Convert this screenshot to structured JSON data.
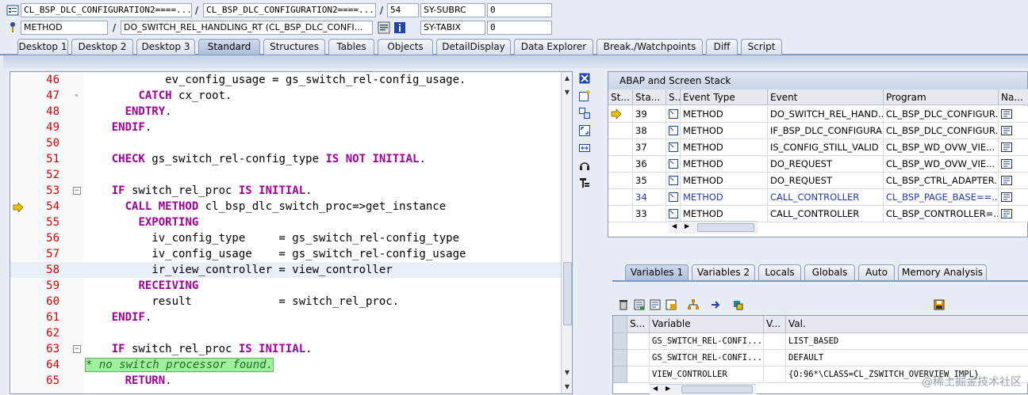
{
  "header": {
    "row1": {
      "program": "CL_BSP_DLC_CONFIGURATION2====...",
      "include": "CL_BSP_DLC_CONFIGURATION2====...",
      "line": "54",
      "sysvar_name": "SY-SUBRC",
      "sysvar_value": "0"
    },
    "row2": {
      "event_type": "METHOD",
      "event": "DO_SWITCH_REL_HANDLING_RT (CL_BSP_DLC_CONFI...",
      "sysvar_name": "SY-TABIX",
      "sysvar_value": "0"
    },
    "separator": "/"
  },
  "tabs": [
    "Desktop 1",
    "Desktop 2",
    "Desktop 3",
    "Standard",
    "Structures",
    "Tables",
    "Objects",
    "DetailDisplay",
    "Data Explorer",
    "Break./Watchpoints",
    "Diff",
    "Script"
  ],
  "code": [
    {
      "n": "46",
      "t": "            ev_config_usage = gs_switch_rel-config_usage."
    },
    {
      "n": "47",
      "t": "        CATCH cx_root."
    },
    {
      "n": "48",
      "t": "      ENDTRY."
    },
    {
      "n": "49",
      "t": "    ENDIF."
    },
    {
      "n": "50",
      "t": ""
    },
    {
      "n": "51",
      "t": "    CHECK gs_switch_rel-config_type IS NOT INITIAL."
    },
    {
      "n": "52",
      "t": ""
    },
    {
      "n": "53",
      "t": "    IF switch_rel_proc IS INITIAL."
    },
    {
      "n": "54",
      "t": "      CALL METHOD cl_bsp_dlc_switch_proc=>get_instance"
    },
    {
      "n": "55",
      "t": "        EXPORTING"
    },
    {
      "n": "56",
      "t": "          iv_config_type     = gs_switch_rel-config_type"
    },
    {
      "n": "57",
      "t": "          iv_config_usage    = gs_switch_rel-config_usage"
    },
    {
      "n": "58",
      "t": "          ir_view_controller = view_controller"
    },
    {
      "n": "59",
      "t": "        RECEIVING"
    },
    {
      "n": "60",
      "t": "          result             = switch_rel_proc."
    },
    {
      "n": "61",
      "t": "    ENDIF."
    },
    {
      "n": "62",
      "t": ""
    },
    {
      "n": "63",
      "t": "    IF switch_rel_proc IS INITIAL."
    },
    {
      "n": "64",
      "t": "* no switch processor found."
    },
    {
      "n": "65",
      "t": "      RETURN."
    }
  ],
  "stack": {
    "title": "ABAP and Screen Stack",
    "columns": [
      "St...",
      "Sta...",
      "S...",
      "Event Type",
      "Event",
      "Program",
      "Na..."
    ],
    "rows": [
      {
        "level": "39",
        "type": "METHOD",
        "event": "DO_SWITCH_REL_HAND...",
        "program": "CL_BSP_DLC_CONFIGUR...",
        "current": true
      },
      {
        "level": "38",
        "type": "METHOD",
        "event": "IF_BSP_DLC_CONFIGURA...",
        "program": "CL_BSP_DLC_CONFIGUR..."
      },
      {
        "level": "37",
        "type": "METHOD",
        "event": "IS_CONFIG_STILL_VALID",
        "program": "CL_BSP_WD_OVW_VIE..."
      },
      {
        "level": "36",
        "type": "METHOD",
        "event": "DO_REQUEST",
        "program": "CL_BSP_WD_OVW_VIE..."
      },
      {
        "level": "35",
        "type": "METHOD",
        "event": "DO_REQUEST",
        "program": "CL_BSP_CTRL_ADAPTER..."
      },
      {
        "level": "34",
        "type": "METHOD",
        "event": "CALL_CONTROLLER",
        "program": "CL_BSP_PAGE_BASE==...",
        "link": true
      },
      {
        "level": "33",
        "type": "METHOD",
        "event": "CALL_CONTROLLER",
        "program": "CL_BSP_CONTROLLER=..."
      }
    ]
  },
  "var_tabs": [
    "Variables 1",
    "Variables 2",
    "Locals",
    "Globals",
    "Auto",
    "Memory Analysis"
  ],
  "vars": {
    "columns": [
      "S...",
      "Variable",
      "V...",
      "Val."
    ],
    "rows": [
      {
        "name": "GS_SWITCH_REL-CONFI...",
        "value": "LIST_BASED"
      },
      {
        "name": "GS_SWITCH_REL-CONFI...",
        "value": "DEFAULT"
      },
      {
        "name": "VIEW_CONTROLLER",
        "value": "{O:96*\\CLASS=CL_ZSWITCH_OVERVIEW_IMPL}"
      }
    ]
  },
  "watermark": "@稀土掘金技术社区",
  "colors": {
    "keyword": "#a0009a",
    "line_number": "#d40000",
    "comment_bg": "#9ef09e",
    "accent": "#7e97bd"
  }
}
